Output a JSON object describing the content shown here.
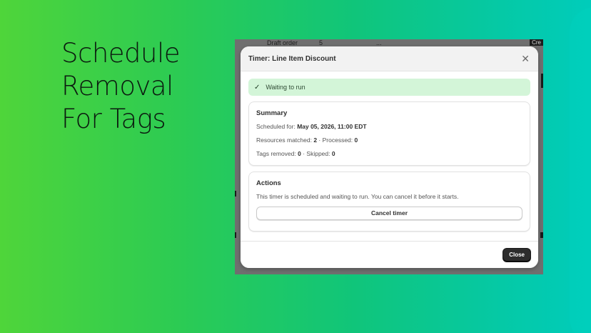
{
  "headline": {
    "line1": "Schedule",
    "line2": "Removal",
    "line3": "For Tags"
  },
  "background": {
    "row_label": "Draft order",
    "row_count": "5",
    "row_more": "...",
    "create_tag": "Cre"
  },
  "modal": {
    "title": "Timer: Line Item Discount",
    "close_glyph": "✕",
    "banner": {
      "icon": "check-icon",
      "text": "Waiting to run"
    },
    "summary": {
      "heading": "Summary",
      "scheduled_label": "Scheduled for: ",
      "scheduled_value": "May 05, 2026, 11:00 EDT",
      "matched_label": "Resources matched: ",
      "matched_value": "2",
      "processed_label": " · Processed: ",
      "processed_value": "0",
      "removed_label": "Tags removed: ",
      "removed_value": "0",
      "skipped_label": " · Skipped: ",
      "skipped_value": "0"
    },
    "actions": {
      "heading": "Actions",
      "description": "This timer is scheduled and waiting to run. You can cancel it before it starts.",
      "cancel_label": "Cancel timer"
    },
    "footer": {
      "close_label": "Close"
    }
  },
  "colors": {
    "banner_bg": "#d3f5d8",
    "primary_button": "#2d2d2d",
    "gradient_start": "#4fd53a",
    "gradient_end": "#00ccbb"
  }
}
